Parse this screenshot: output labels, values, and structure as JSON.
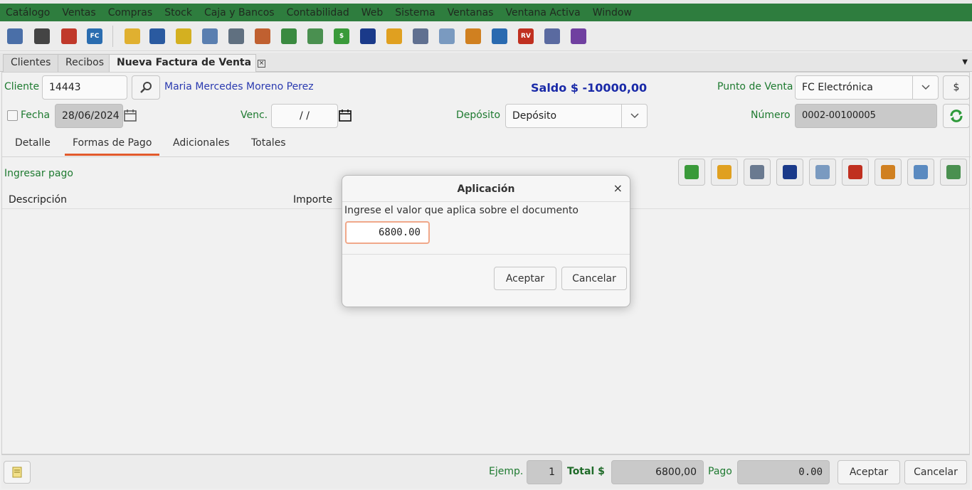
{
  "menu": [
    "Catálogo",
    "Ventas",
    "Compras",
    "Stock",
    "Caja y Bancos",
    "Contabilidad",
    "Web",
    "Sistema",
    "Ventanas",
    "Ventana Activa",
    "Window"
  ],
  "toolbar": {
    "icons": [
      {
        "name": "book-icon",
        "color": "#4a6fa8"
      },
      {
        "name": "barcode-icon",
        "color": "#444444"
      },
      {
        "name": "truck-icon",
        "color": "#c0392b"
      },
      {
        "name": "invoice-fc-icon",
        "color": "#2a6db0",
        "text": "FC"
      },
      {
        "name": "document-icon",
        "color": "#e0b030"
      },
      {
        "name": "save-icon",
        "color": "#2a5aa0"
      },
      {
        "name": "notes-icon",
        "color": "#d4b020"
      },
      {
        "name": "report-icon",
        "color": "#5a7fb0"
      },
      {
        "name": "search-doc-icon",
        "color": "#607080"
      },
      {
        "name": "transfer-icon",
        "color": "#c06030"
      },
      {
        "name": "percent-icon",
        "color": "#3a8a40"
      },
      {
        "name": "edit-money-icon",
        "color": "#4a9050"
      },
      {
        "name": "dollar-icon",
        "color": "#3a9a3a",
        "text": "$"
      },
      {
        "name": "card-icon",
        "color": "#1a3a8a"
      },
      {
        "name": "user-icon",
        "color": "#e0a020"
      },
      {
        "name": "copy-docs-icon",
        "color": "#607090"
      },
      {
        "name": "check-icon",
        "color": "#7a9ac0"
      },
      {
        "name": "receipt-icon",
        "color": "#d08020"
      },
      {
        "name": "shield-icon",
        "color": "#2a6ab0"
      },
      {
        "name": "rv-icon",
        "color": "#c03020",
        "text": "RV"
      },
      {
        "name": "calc-icon",
        "color": "#5a6aa0"
      },
      {
        "name": "box-icon",
        "color": "#7040a0"
      }
    ]
  },
  "tabs": {
    "clientes": "Clientes",
    "recibos": "Recibos",
    "nueva_factura": "Nueva Factura de Venta",
    "close": "×"
  },
  "form": {
    "cliente_label": "Cliente",
    "cliente_code": "14443",
    "cliente_name": "Maria Mercedes Moreno Perez",
    "saldo": "Saldo $ -10000,00",
    "punto_venta_label": "Punto de Venta",
    "punto_venta_value": "FC Electrónica",
    "currency_btn": "$",
    "fecha_label": "Fecha",
    "fecha_value": "28/06/2024",
    "venc_label": "Venc.",
    "venc_value": "/ /",
    "deposito_label": "Depósito",
    "deposito_value": "Depósito",
    "numero_label": "Número",
    "numero_value": "0002-00100005"
  },
  "subtabs": [
    "Detalle",
    "Formas de Pago",
    "Adicionales",
    "Totales"
  ],
  "pago": {
    "ingresar_label": "Ingresar pago",
    "col_descripcion": "Descripción",
    "col_importe": "Importe",
    "buttons": [
      {
        "name": "pay-cash-icon",
        "color": "#3a9a3a"
      },
      {
        "name": "pay-user-icon",
        "color": "#e0a020"
      },
      {
        "name": "pay-transfer-icon",
        "color": "#6a7a90"
      },
      {
        "name": "pay-card-icon",
        "color": "#1a3a8a"
      },
      {
        "name": "pay-check-icon",
        "color": "#7a9ac0"
      },
      {
        "name": "pay-bank-icon",
        "color": "#c03020"
      },
      {
        "name": "pay-receipt-icon",
        "color": "#d08020"
      },
      {
        "name": "pay-shield-icon",
        "color": "#5a8ac0"
      },
      {
        "name": "pay-edit-icon",
        "color": "#4a9050"
      }
    ]
  },
  "footer": {
    "ejemp_label": "Ejemp.",
    "ejemp_value": "1",
    "total_label": "Total $",
    "total_value": "6800,00",
    "pago_label": "Pago",
    "pago_value": "0.00",
    "aceptar": "Aceptar",
    "cancelar": "Cancelar"
  },
  "dialog": {
    "title": "Aplicación",
    "close": "×",
    "message": "Ingrese el valor que aplica sobre el documento",
    "input_value": "6800.00",
    "aceptar": "Aceptar",
    "cancelar": "Cancelar"
  }
}
